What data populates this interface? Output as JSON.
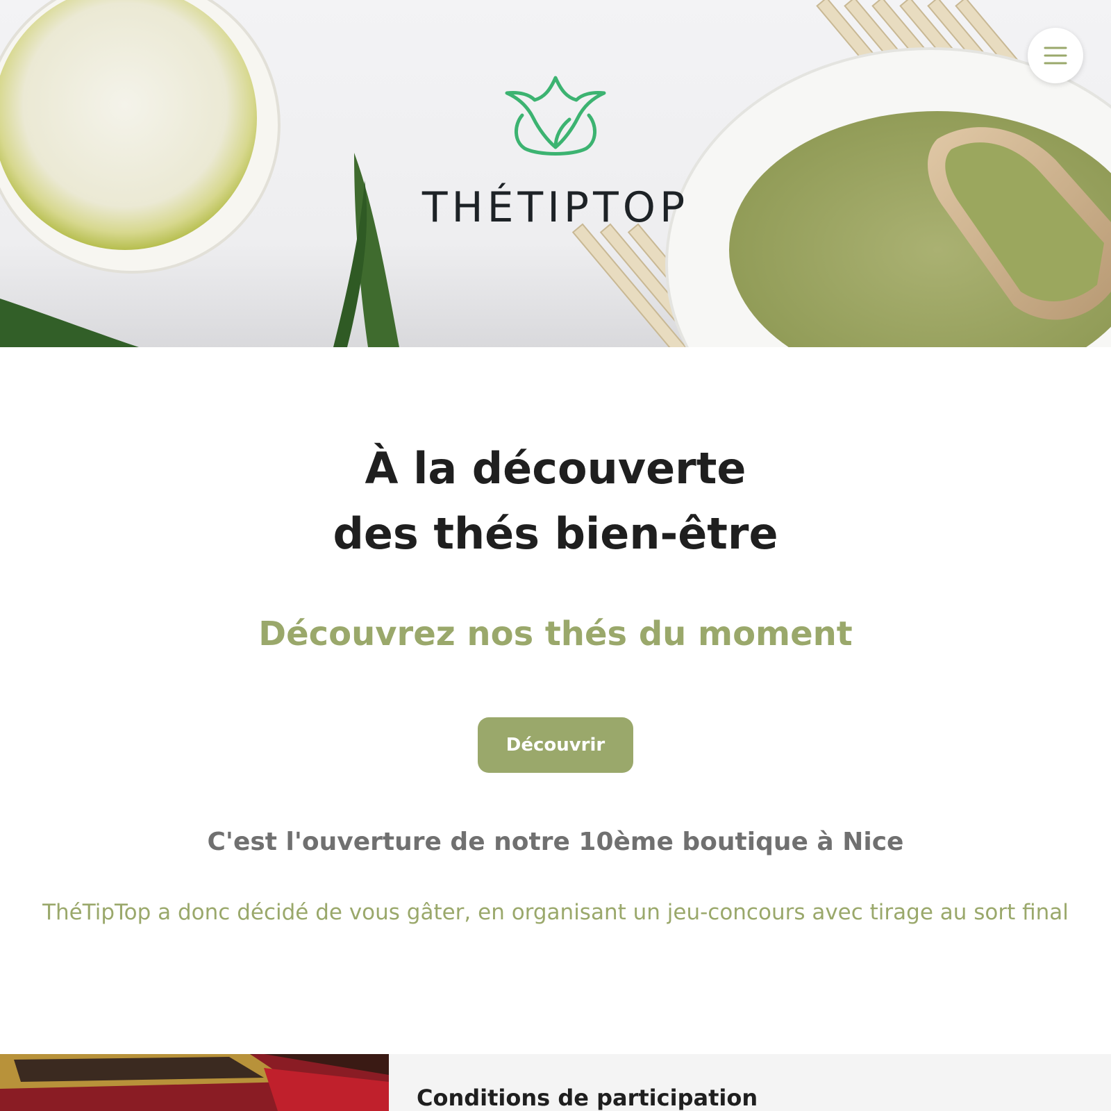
{
  "brand": {
    "name": "THÉTIPTOP"
  },
  "header": {
    "menu_icon": "hamburger-menu-icon"
  },
  "hero": {
    "headline_line1": "À la découverte",
    "headline_line2": "des thés bien-être",
    "subheadline": "Découvrez nos thés du moment",
    "cta_label": "Découvrir"
  },
  "promo": {
    "opening": "C'est l'ouverture de notre 10ème boutique à Nice",
    "description": "ThéTipTop a donc décidé de vous gâter, en organisant un jeu-concours avec tirage au sort final"
  },
  "conditions": {
    "title": "Conditions de participation"
  },
  "colors": {
    "accent": "#9aa86b",
    "logo_green": "#3cb371",
    "text_dark": "#1f1f1f",
    "text_gray": "#707070"
  }
}
